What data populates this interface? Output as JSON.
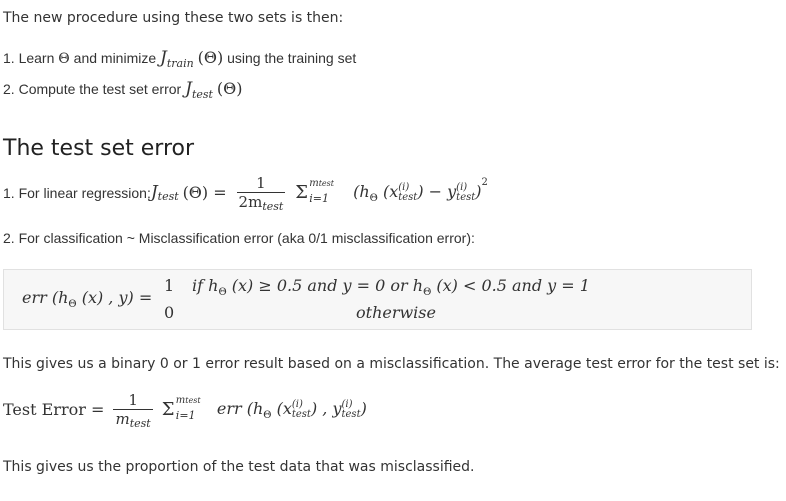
{
  "intro": "The new procedure using these two sets is then:",
  "steps": [
    {
      "num": "1.",
      "before": "Learn ",
      "theta": "Θ",
      "mid": " and minimize ",
      "J": "J",
      "sub": "train",
      "arg": "(Θ)",
      "after": " using the training set"
    },
    {
      "num": "2.",
      "before": "Compute the test set error ",
      "J": "J",
      "sub": "test",
      "arg": "(Θ)"
    }
  ],
  "heading": "The test set error",
  "linear": {
    "label": "1. For linear regression: ",
    "J": "J",
    "sub": "test",
    "arg": "(Θ) =",
    "frac_num": "1",
    "frac_den": "2m",
    "frac_den_sub": "test",
    "sum": "Σ",
    "sum_top": "m",
    "sum_top_sub": "test",
    "sum_bottom": "i=1",
    "body": "(h",
    "body_sub": "Θ",
    "body_x": " (x",
    "body_x_sup": "(i)",
    "body_x_sub": "test",
    "body_minus": ") − y",
    "body_y_sup": "(i)",
    "body_y_sub": "test",
    "body_end": ")",
    "power": "2"
  },
  "classification": "2. For classification ~ Misclassification error (aka 0/1 misclassification error):",
  "err_box": {
    "lhs": "err (h",
    "lhs_sub": "Θ",
    "lhs_rest": " (x) , y) =",
    "case1_val": "1",
    "case1_cond": "if h",
    "case1_sub": "Θ",
    "case1_mid": " (x) ≥ 0.5 and y = 0 or h",
    "case1_sub2": "Θ",
    "case1_end": " (x) < 0.5 and y = 1",
    "case2_val": "0",
    "case2_cond": "otherwise"
  },
  "binary_text": "This gives us a binary 0 or 1 error result based on a misclassification. The average test error for the test set is:",
  "test_error": {
    "label": "Test Error =",
    "frac_num": "1",
    "frac_den": "m",
    "frac_den_sub": "test",
    "sum": "Σ",
    "sum_top": "m",
    "sum_top_sub": "test",
    "sum_bottom": "i=1",
    "body": "err (h",
    "body_sub": "Θ",
    "body_x": " (x",
    "body_x_sup": "(i)",
    "body_x_sub": "test",
    "body_mid": ") , y",
    "body_y_sup": "(i)",
    "body_y_sub": "test",
    "body_end": ")"
  },
  "conclusion": "This gives us the proportion of the test data that was misclassified."
}
